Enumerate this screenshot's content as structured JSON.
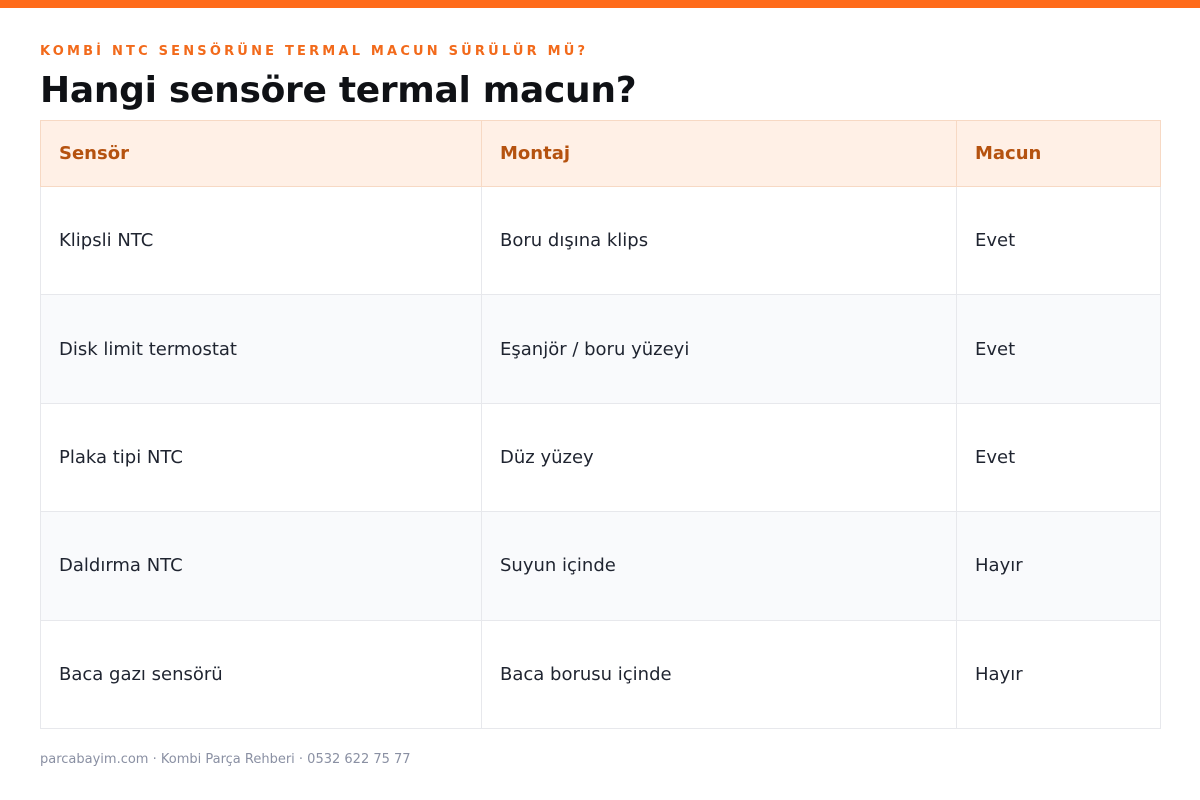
{
  "header": {
    "kicker": "KOMBİ NTC SENSÖRÜNE TERMAL MACUN SÜRÜLÜR MÜ?",
    "title": "Hangi sensöre termal macun?"
  },
  "table": {
    "columns": [
      "Sensör",
      "Montaj",
      "Macun"
    ],
    "rows": [
      [
        "Klipsli NTC",
        "Boru dışına klips",
        "Evet"
      ],
      [
        "Disk limit termostat",
        "Eşanjör / boru yüzeyi",
        "Evet"
      ],
      [
        "Plaka tipi NTC",
        "Düz yüzey",
        "Evet"
      ],
      [
        "Daldırma NTC",
        "Suyun içinde",
        "Hayır"
      ],
      [
        "Baca gazı sensörü",
        "Baca borusu içinde",
        "Hayır"
      ]
    ]
  },
  "footer": {
    "text": "parcabayim.com · Kombi Parça Rehberi · 0532 622 75 77"
  },
  "colors": {
    "accent": "#ff6b1a",
    "header_bg": "#fff0e6",
    "header_text": "#b5520f"
  }
}
